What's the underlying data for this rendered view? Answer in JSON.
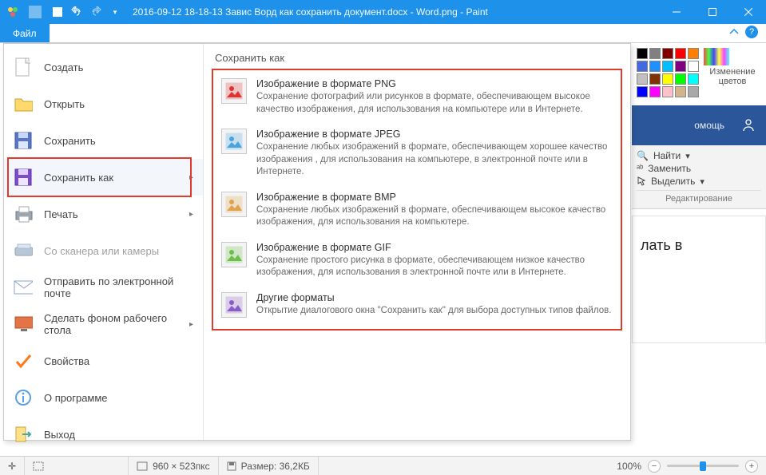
{
  "title": "2016-09-12 18-18-13 Завис Ворд как сохранить документ.docx - Word.png - Paint",
  "file_tab": "Файл",
  "sidebar": [
    {
      "id": "create",
      "label": "Создать",
      "icon": "document-new-icon"
    },
    {
      "id": "open",
      "label": "Открыть",
      "icon": "folder-open-icon"
    },
    {
      "id": "save",
      "label": "Сохранить",
      "icon": "floppy-icon"
    },
    {
      "id": "saveas",
      "label": "Сохранить как",
      "icon": "floppy-as-icon",
      "arrow": true,
      "highlight": true
    },
    {
      "id": "print",
      "label": "Печать",
      "icon": "printer-icon",
      "arrow": true
    },
    {
      "id": "scanner",
      "label": "Со сканера или камеры",
      "icon": "scanner-icon",
      "disabled": true
    },
    {
      "id": "email",
      "label": "Отправить по электронной почте",
      "icon": "mail-icon"
    },
    {
      "id": "wallpaper",
      "label": "Сделать фоном рабочего стола",
      "icon": "desktop-icon",
      "arrow": true
    },
    {
      "id": "props",
      "label": "Свойства",
      "icon": "check-icon"
    },
    {
      "id": "about",
      "label": "О программе",
      "icon": "info-icon"
    },
    {
      "id": "exit",
      "label": "Выход",
      "icon": "exit-icon"
    }
  ],
  "submenu": {
    "heading": "Сохранить как",
    "options": [
      {
        "id": "png",
        "title": "Изображение в формате PNG",
        "desc": "Сохранение фотографий или рисунков в формате, обеспечивающем высокое качество изображения, для использования на компьютере или в Интернете."
      },
      {
        "id": "jpeg",
        "title": "Изображение в формате JPEG",
        "desc": "Сохранение любых изображений в формате, обеспечивающем хорошее качество изображения , для использования на компьютере, в электронной почте или в Интернете."
      },
      {
        "id": "bmp",
        "title": "Изображение в формате BMP",
        "desc": "Сохранение любых изображений в формате, обеспечивающем высокое качество изображения, для использования на компьютере."
      },
      {
        "id": "gif",
        "title": "Изображение в формате GIF",
        "desc": "Сохранение простого рисунка в формате, обеспечивающем низкое качество изображения, для использования в электронной почте или в Интернете."
      },
      {
        "id": "other",
        "title": "Другие форматы",
        "desc": "Открытие диалогового окна \"Сохранить как\" для выбора доступных типов файлов."
      }
    ]
  },
  "right": {
    "edit_colors": "Изменение цветов",
    "swatch_colors": [
      "#000000",
      "#808080",
      "#800000",
      "#ff0000",
      "#ff8000",
      "#4169e1",
      "#1e90ff",
      "#00bfff",
      "#800080",
      "#ffffff",
      "#c0c0c0",
      "#803300",
      "#ffff00",
      "#00ff00",
      "#00ffff",
      "#0000ff",
      "#ff00ff",
      "#ffc0cb",
      "#d2b48c",
      "#a9a9a9"
    ],
    "word_tab": "омощь",
    "find": "Найти",
    "replace": "Заменить",
    "select": "Выделить",
    "group": "Редактирование",
    "doc_text": "лать в"
  },
  "statusbar": {
    "coord_icon": "✛",
    "dims_label": "960 × 523пкс",
    "size_label": "Размер: 36,2КБ",
    "zoom": "100%"
  }
}
